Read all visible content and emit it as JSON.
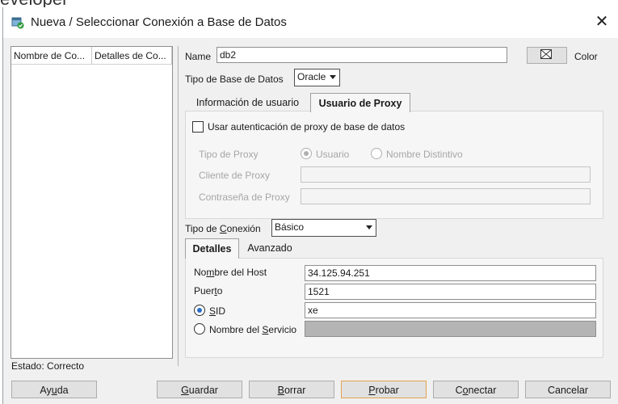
{
  "window": {
    "title": "Nueva / Seleccionar Conexión a Base de Datos",
    "close_glyph": "✕",
    "background_text": "eveloper",
    "icon": "database-connection-icon"
  },
  "connections_table": {
    "columns": [
      "Nombre de Co...",
      "Detalles de Co..."
    ]
  },
  "form": {
    "name_label": "Name",
    "name_value": "db2",
    "color_label": "Color",
    "db_type_label": "Tipo de Base de Datos",
    "db_type_value": "Oracle",
    "tabs_top": [
      "Información de usuario",
      "Usuario de Proxy"
    ],
    "proxy": {
      "use_proxy_label": "Usar autenticación de proxy de base de datos",
      "proxy_type_label": "Tipo de Proxy",
      "radio_user": "Usuario",
      "radio_distinguished": "Nombre Distintivo",
      "proxy_client_label": "Cliente de Proxy",
      "proxy_password_label": "Contraseña de Proxy"
    },
    "connection_type_label_pre": "Tipo de ",
    "connection_type_label_u": "C",
    "connection_type_label_post": "onexión",
    "connection_type_value": "Básico",
    "tabs_bottom": [
      "Detalles",
      "Avanzado"
    ],
    "details": {
      "host_label_pre": "No",
      "host_label_u": "m",
      "host_label_post": "bre del Host",
      "host_value": "34.125.94.251",
      "port_label_pre": "Puer",
      "port_label_u": "t",
      "port_label_post": "o",
      "port_value": "1521",
      "sid_label_u": "S",
      "sid_label_post": "ID",
      "sid_value": "xe",
      "service_label_pre": "Nombre del ",
      "service_label_u": "S",
      "service_label_post": "ervicio",
      "service_value": ""
    }
  },
  "status": "Estado: Correcto",
  "buttons": {
    "help_pre": "Ay",
    "help_u": "u",
    "help_post": "da",
    "save_u": "G",
    "save_post": "uardar",
    "delete_u": "B",
    "delete_post": "orrar",
    "test_u": "P",
    "test_post": "robar",
    "connect_pre": "C",
    "connect_u": "o",
    "connect_post": "nectar",
    "cancel": "Cancelar"
  }
}
